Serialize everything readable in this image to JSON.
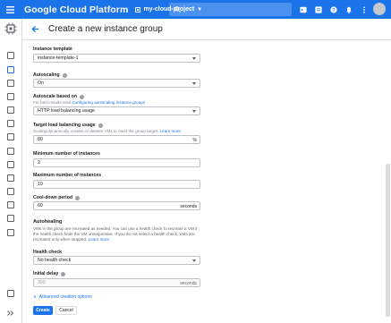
{
  "topbar": {
    "brand": "Google Cloud Platform",
    "project": "my-cloud-project",
    "icons": [
      "menu-icon",
      "search-icon",
      "cloud-shell-icon",
      "support-icon",
      "help-icon",
      "notifications-icon",
      "more-icon"
    ],
    "accent": "#1a73e8"
  },
  "header": {
    "title": "Create a new instance group"
  },
  "form": {
    "instance_template": {
      "label": "Instance template",
      "value": "instance-template-1"
    },
    "autoscaling": {
      "label": "Autoscaling",
      "value": "On"
    },
    "autoscale_based_on": {
      "label": "Autoscale based on",
      "hint": "For best results read",
      "hint_link": "Configuring autoscaling instance groups",
      "value": "HTTP load balancing usage"
    },
    "target_lb_usage": {
      "label": "Target load balancing usage",
      "hint": "Scaling dynamically creates or deletes VMs to meet the group target.",
      "hint_link": "Learn more",
      "value": "80",
      "suffix": "%"
    },
    "min_instances": {
      "label": "Minimum number of instances",
      "value": "2"
    },
    "max_instances": {
      "label": "Maximum number of instances",
      "value": "10"
    },
    "cooldown": {
      "label": "Cool-down period",
      "value": "60",
      "suffix": "seconds"
    },
    "autohealing": {
      "title": "Autohealing",
      "text": "VMs in the group are recreated as needed. You can use a health check to recreate a VM if the health check finds the VM unresponsive. If you do not select a health check, VMs are recreated only when stopped.",
      "link": "Learn more"
    },
    "health_check": {
      "label": "Health check",
      "value": "No health check"
    },
    "initial_delay": {
      "label": "Initial delay",
      "value": "300",
      "suffix": "seconds"
    },
    "advanced": "Advanced creation options",
    "create": "Create",
    "cancel": "Cancel"
  }
}
